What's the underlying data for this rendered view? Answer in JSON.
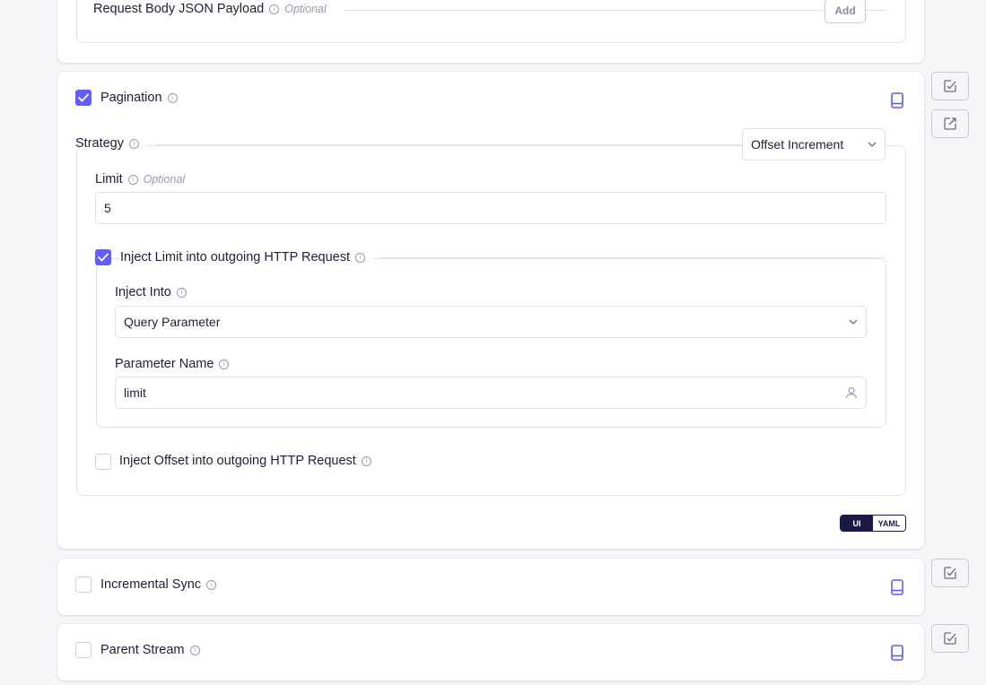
{
  "request_body": {
    "label": "Request Body JSON Payload",
    "optional": "Optional",
    "add_label": "Add"
  },
  "pagination": {
    "label": "Pagination",
    "checked": true,
    "strategy": {
      "label": "Strategy",
      "value": "Offset Increment"
    },
    "limit": {
      "label": "Limit",
      "optional": "Optional",
      "value": "5"
    },
    "inject_limit": {
      "label": "Inject Limit into outgoing HTTP Request",
      "checked": true,
      "inject_into": {
        "label": "Inject Into",
        "value": "Query Parameter"
      },
      "parameter_name": {
        "label": "Parameter Name",
        "value": "limit"
      }
    },
    "inject_offset": {
      "label": "Inject Offset into outgoing HTTP Request",
      "checked": false
    },
    "view_toggle": {
      "ui": "UI",
      "yaml": "YAML",
      "active": "UI"
    }
  },
  "incremental_sync": {
    "label": "Incremental Sync",
    "checked": false
  },
  "parent_stream": {
    "label": "Parent Stream",
    "checked": false
  },
  "colors": {
    "accent": "#615eff",
    "dark": "#1a1a45",
    "border": "#e2e2ea",
    "background": "#f6f6f9"
  },
  "icons": {
    "side_buttons": [
      "edit-check-icon",
      "external-link-icon",
      "edit-check-icon",
      "edit-check-icon"
    ],
    "docs": "book-icon"
  }
}
